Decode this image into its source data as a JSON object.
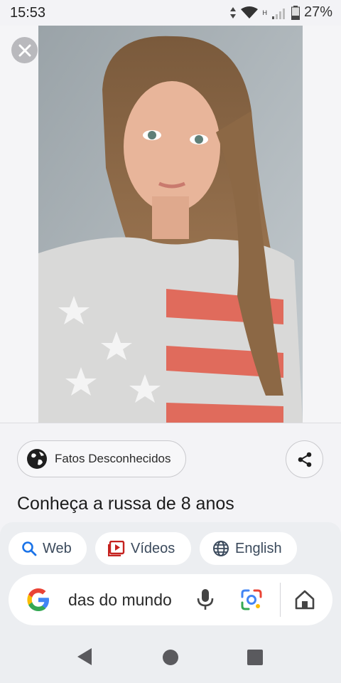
{
  "status_bar": {
    "time": "15:53",
    "network_label": "H",
    "battery": "27%"
  },
  "image_viewer": {
    "close_icon": "close-icon"
  },
  "result": {
    "source_name": "Fatos Desconhecidos",
    "source_icon": "globe-icon",
    "share_icon": "share-icon",
    "title": "Conheça a russa de 8 anos"
  },
  "filters": {
    "web_label": "Web",
    "videos_label": "Vídeos",
    "english_label": "English"
  },
  "search": {
    "query_visible": "das do mundo"
  },
  "colors": {
    "accent_blue": "#1a73e8",
    "video_red": "#c5221f",
    "chip_text": "#3b4a5c"
  }
}
